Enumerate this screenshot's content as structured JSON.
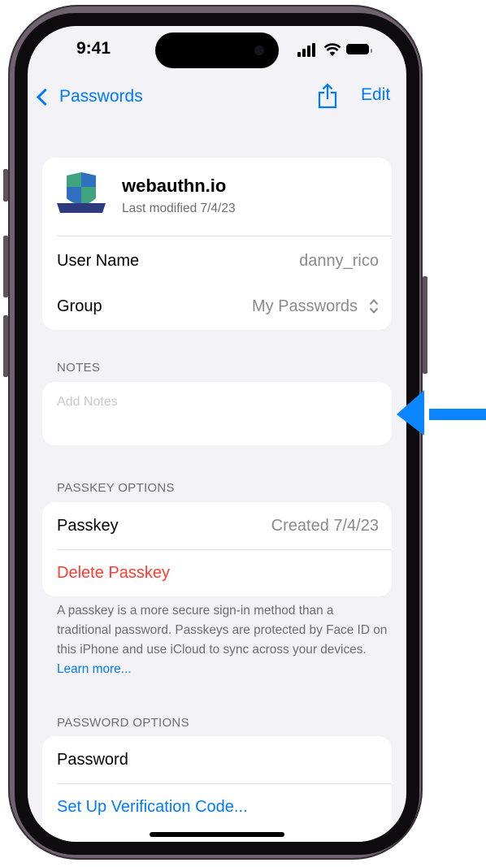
{
  "status": {
    "time": "9:41"
  },
  "nav": {
    "back_label": "Passwords",
    "edit_label": "Edit"
  },
  "site": {
    "name": "webauthn.io",
    "modified": "Last modified 7/4/23"
  },
  "fields": [
    {
      "label": "User Name",
      "value": "danny_rico"
    },
    {
      "label": "Group",
      "value": "My Passwords"
    }
  ],
  "notes": {
    "header": "NOTES",
    "placeholder": "Add Notes"
  },
  "passkey": {
    "header": "PASSKEY OPTIONS",
    "label": "Passkey",
    "value": "Created 7/4/23",
    "delete_label": "Delete Passkey",
    "footer": "A passkey is a more secure sign-in method than a traditional password. Passkeys are protected by Face ID on this iPhone and use iCloud to sync across your devices.",
    "learn_more": "Learn more..."
  },
  "password": {
    "header": "PASSWORD OPTIONS",
    "label": "Password",
    "verification_label": "Set Up Verification Code..."
  },
  "colors": {
    "accent": "#007aff",
    "destructive": "#ff3b30",
    "callout_arrow": "#0a84ff"
  },
  "icons": [
    "back-chevron-icon",
    "share-icon",
    "site-logo-icon",
    "updown-chevron-icon",
    "signal-icon",
    "wifi-icon",
    "battery-icon"
  ]
}
